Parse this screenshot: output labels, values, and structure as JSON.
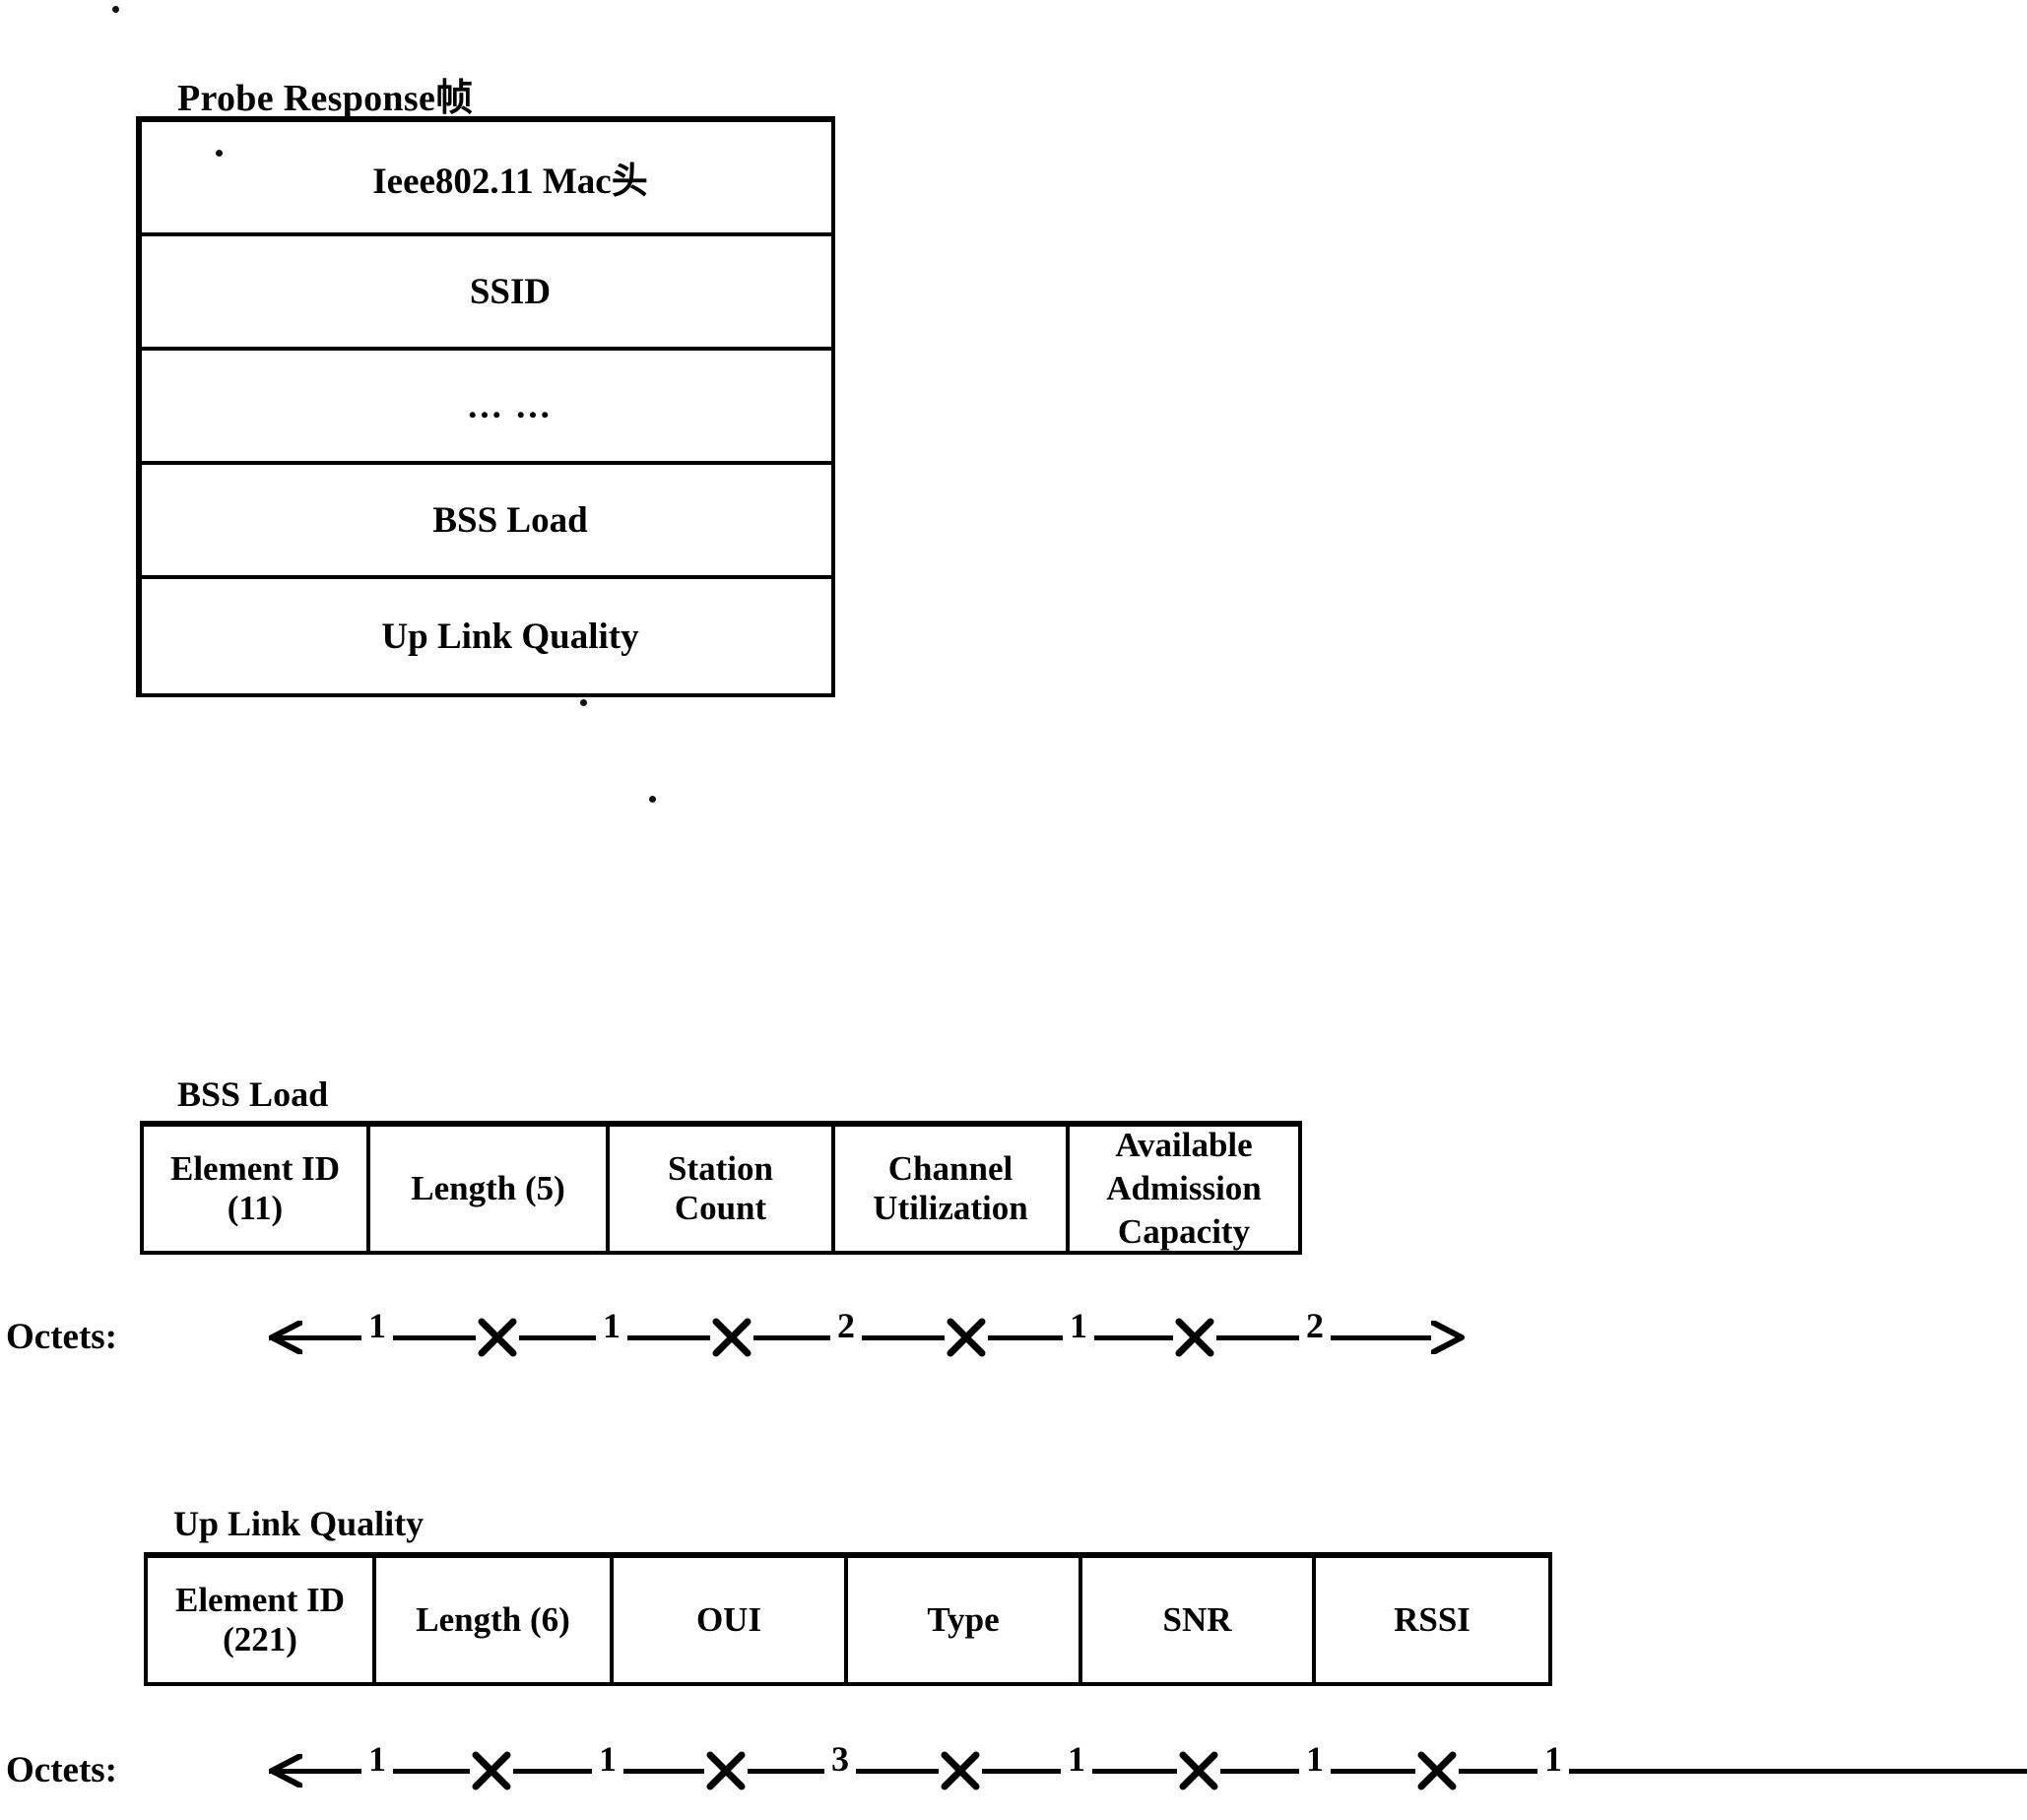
{
  "diagram": {
    "frame": {
      "title": "Probe Response帧",
      "rows": [
        {
          "label": "Ieee802.11 Mac头"
        },
        {
          "label": "SSID"
        },
        {
          "label": "... ..."
        },
        {
          "label": "BSS Load"
        },
        {
          "label": "Up Link Quality"
        }
      ]
    },
    "bss_load": {
      "caption": "BSS Load",
      "octets_label": "Octets:",
      "fields": [
        {
          "name": "Element ID\n(11)",
          "octets": "1"
        },
        {
          "name": "Length (5)",
          "octets": "1"
        },
        {
          "name": "Station\nCount",
          "octets": "2"
        },
        {
          "name": "Channel\nUtilization",
          "octets": "1"
        },
        {
          "name": "Available\nAdmission\nCapacity",
          "octets": "2"
        }
      ]
    },
    "up_link_quality": {
      "caption": "Up Link Quality",
      "octets_label": "Octets:",
      "fields": [
        {
          "name": "Element ID\n(221)",
          "octets": "1"
        },
        {
          "name": "Length (6)",
          "octets": "1"
        },
        {
          "name": "OUI",
          "octets": "3"
        },
        {
          "name": "Type",
          "octets": "1"
        },
        {
          "name": "SNR",
          "octets": "1"
        },
        {
          "name": "RSSI",
          "octets": "1"
        }
      ]
    }
  },
  "layout": {
    "bss_load_col_widths": [
      230,
      243,
      229,
      238,
      232
    ],
    "up_link_col_widths": [
      232,
      241,
      238,
      238,
      237,
      236
    ]
  }
}
